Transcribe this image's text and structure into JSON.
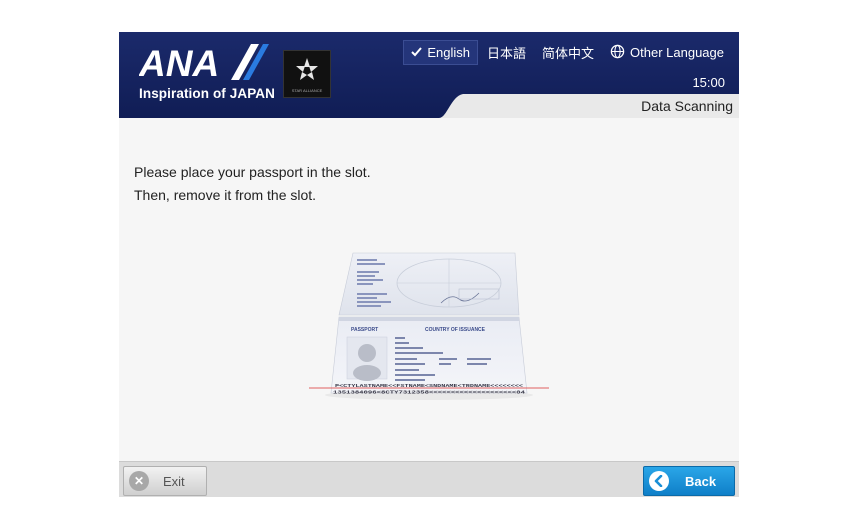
{
  "brand": {
    "name": "ANA",
    "tagline": "Inspiration of JAPAN",
    "alliance": "STAR ALLIANCE"
  },
  "languages": [
    {
      "label": "English",
      "selected": true
    },
    {
      "label": "日本語"
    },
    {
      "label": "简体中文"
    },
    {
      "label": "Other Language"
    }
  ],
  "clock": "15:00",
  "screen_title": "Data Scanning",
  "instructions": [
    "Please place your passport in the slot.",
    "Then, remove it from the slot."
  ],
  "passport": {
    "label_passport": "PASSPORT",
    "label_country": "COUNTRY OF ISSUANCE",
    "mrz_line1": "P<CTYLASTNAME<<FSTNAME<SNDNAME<TRDNAME<<<<<<<<",
    "mrz_line2": "1351384096<8CTY7312358<<<<<<<<<<<<<<<<<<<<04"
  },
  "footer": {
    "exit_label": "Exit",
    "back_label": "Back"
  },
  "colors": {
    "header_navy": "#14235f",
    "accent_blue": "#1a8fd6"
  }
}
